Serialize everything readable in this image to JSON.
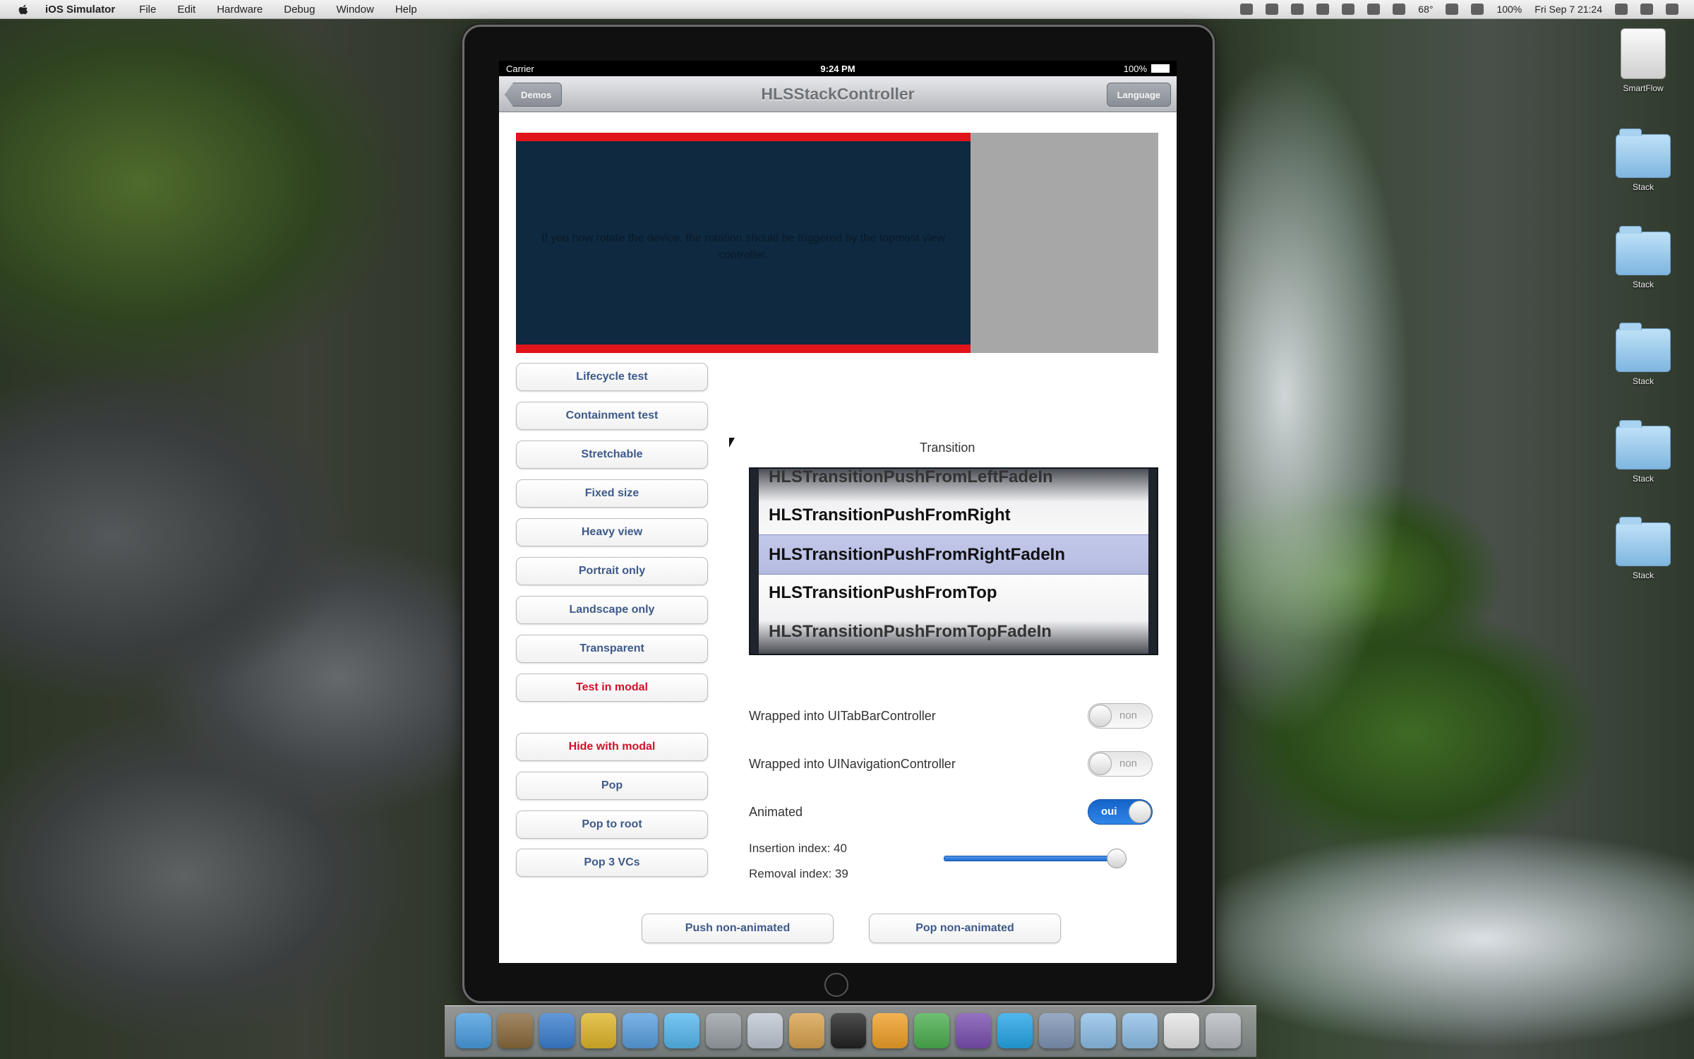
{
  "menubar": {
    "app_name": "iOS Simulator",
    "menus": [
      "File",
      "Edit",
      "Hardware",
      "Debug",
      "Window",
      "Help"
    ],
    "status": {
      "temperature": "68°",
      "battery": "100%",
      "datetime": "Fri Sep 7  21:24"
    }
  },
  "desktop": {
    "icons": [
      {
        "kind": "drive",
        "label": "SmartFlow"
      },
      {
        "kind": "folder",
        "label": "Stack"
      },
      {
        "kind": "folder",
        "label": "Stack"
      },
      {
        "kind": "folder",
        "label": "Stack"
      },
      {
        "kind": "folder",
        "label": "Stack"
      },
      {
        "kind": "folder",
        "label": "Stack"
      }
    ]
  },
  "ios_status": {
    "carrier": "Carrier",
    "time": "9:24 PM",
    "battery": "100%"
  },
  "navbar": {
    "back_label": "Demos",
    "title": "HLSStackController",
    "right_label": "Language"
  },
  "preview": {
    "message": "If you now rotate the device, the rotation should be triggered by the topmost view controller."
  },
  "buttons": [
    {
      "label": "Lifecycle test",
      "red": false
    },
    {
      "label": "Containment test",
      "red": false
    },
    {
      "label": "Stretchable",
      "red": false
    },
    {
      "label": "Fixed size",
      "red": false
    },
    {
      "label": "Heavy view",
      "red": false
    },
    {
      "label": "Portrait only",
      "red": false
    },
    {
      "label": "Landscape only",
      "red": false
    },
    {
      "label": "Transparent",
      "red": false
    },
    {
      "label": "Test in modal",
      "red": true
    },
    {
      "label": "Hide with modal",
      "red": true
    },
    {
      "label": "Pop",
      "red": false
    },
    {
      "label": "Pop to root",
      "red": false
    },
    {
      "label": "Pop 3 VCs",
      "red": false
    }
  ],
  "transition": {
    "label": "Transition",
    "options": [
      "HLSTransitionPushFromLeftFadeIn",
      "HLSTransitionPushFromRight",
      "HLSTransitionPushFromRightFadeIn",
      "HLSTransitionPushFromTop",
      "HLSTransitionPushFromTopFadeIn"
    ],
    "selected": "HLSTransitionPushFromRightFadeIn"
  },
  "switches": [
    {
      "label": "Wrapped into UITabBarController",
      "value": "non",
      "on": false
    },
    {
      "label": "Wrapped into UINavigationController",
      "value": "non",
      "on": false
    },
    {
      "label": "Animated",
      "value": "oui",
      "on": true
    }
  ],
  "indices": {
    "insertion": "Insertion index: 40",
    "removal": "Removal index: 39",
    "slider_value": 0.97
  },
  "bottom_buttons": {
    "push": "Push non-animated",
    "pop": "Pop non-animated"
  },
  "dock": {
    "apps": [
      "finder",
      "preview",
      "xcode",
      "chrome",
      "safari",
      "messages",
      "utilities",
      "mail",
      "keynote",
      "terminal",
      "photos",
      "growl",
      "zip",
      "skype",
      "network",
      "folder",
      "folder",
      "docs",
      "trash"
    ]
  }
}
